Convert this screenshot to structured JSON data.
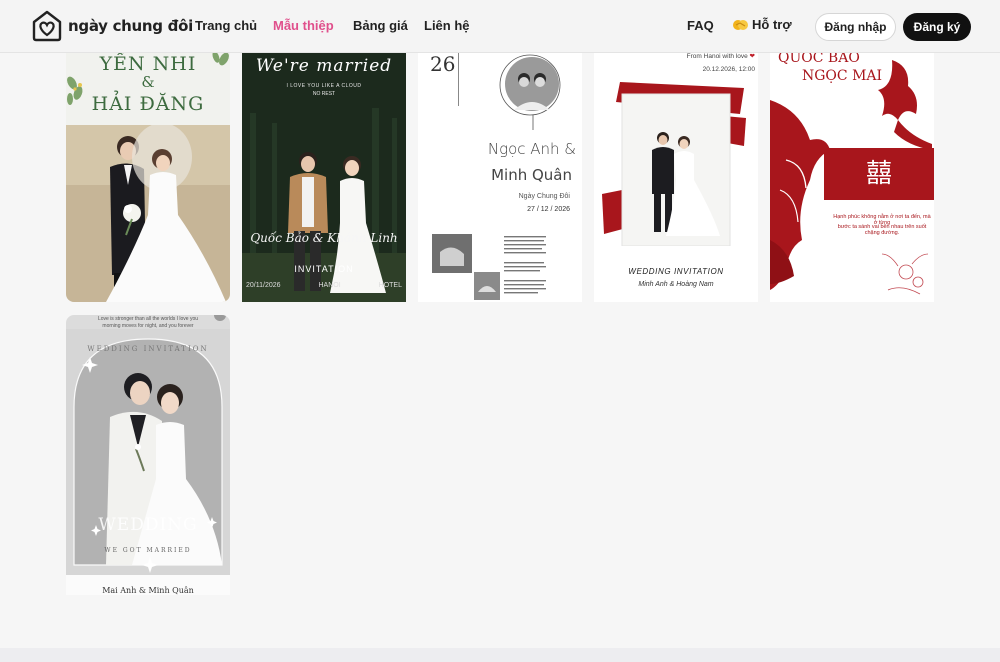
{
  "brand": {
    "name": "ngày chung đôi"
  },
  "nav": {
    "items": [
      {
        "label": "Trang chủ",
        "active": false
      },
      {
        "label": "Mẫu thiệp",
        "active": true
      },
      {
        "label": "Bảng giá",
        "active": false
      },
      {
        "label": "Liên hệ",
        "active": false
      }
    ],
    "faq": "FAQ",
    "support": "Hỗ trợ",
    "login": "Đăng nhập",
    "register": "Đăng ký"
  },
  "colors": {
    "accent": "#e0508c",
    "dark": "#111111",
    "red": "#a8161c"
  },
  "cards": [
    {
      "names_line1": "YẾN NHI",
      "amp": "&",
      "names_line2": "HẢI ĐĂNG"
    },
    {
      "headline": "We're married",
      "sub1": "I LOVE YOU LIKE A CLOUD",
      "sub2": "NO REST",
      "script_names": "Quốc Bảo & Khánh Linh",
      "label": "INVITATION",
      "date": "20/11/2026",
      "city": "HANOI",
      "venue": "HOTEL"
    },
    {
      "day": "26",
      "names_line1": "Ngọc Anh &",
      "names_line2": "Minh Quân",
      "caption": "Ngày Chung Đôi",
      "date_day": "27",
      "date_month": "12",
      "date_year": "2026"
    },
    {
      "from": "From Hanoi with love",
      "datetime": "20.12.2026, 12:00",
      "title": "WEDDING INVITATION",
      "names": "Minh Anh & Hoàng Nam"
    },
    {
      "names_line1": "QUỐC BẢO",
      "names_line2": "NGỌC MAI",
      "symbol": "囍",
      "text_line1": "Hạnh phúc không nằm ở nơi ta đến, mà ở từng",
      "text_line2": "bước ta sánh vai bên nhau trên suốt chặng đường."
    },
    {
      "top_line1": "Love is stronger than all the worlds I love you",
      "top_line2": "morning  moves for night, and you forever",
      "arc": "WEDDING INVITATION",
      "big": "WEDDING",
      "bottom_arc": "WE GOT MARRIED",
      "names": "Mai Anh & Minh Quân"
    }
  ]
}
